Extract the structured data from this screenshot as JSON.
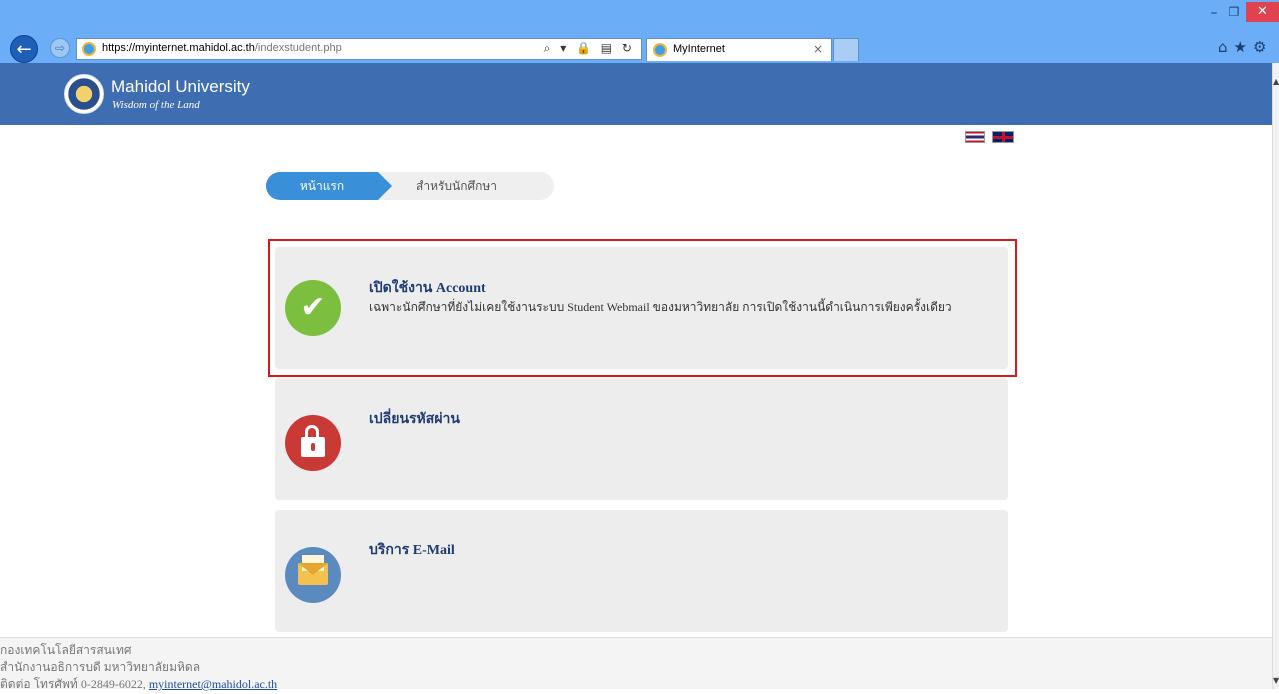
{
  "browser": {
    "url_host": "https://myinternet.mahidol.ac.th",
    "url_path": "/indexstudent.php",
    "address_tools": "⌕ ▾ 🔒 ▤ ↻",
    "tab_title": "MyInternet",
    "tab_close": "×",
    "back_glyph": "←",
    "forward_glyph": "⇨",
    "minimize_glyph": "–",
    "maximize_glyph": "❐",
    "close_glyph": "✕",
    "tool_glyphs": "⌂★⚙"
  },
  "header": {
    "brand_name": "Mahidol University",
    "tagline": "Wisdom of the Land",
    "color": "#3f6db2"
  },
  "breadcrumb": {
    "home": "หน้าแรก",
    "current": "สำหรับนักศึกษา",
    "active_color": "#3a8fd9"
  },
  "services": [
    {
      "title": "เปิดใช้งาน Account",
      "description": "เฉพาะนักศึกษาที่ยังไม่เคยใช้งานระบบ Student Webmail ของมหาวิทยาลัย การเปิดใช้งานนี้ดำเนินการเพียงครั้งเดียว",
      "icon": "check-icon",
      "icon_glyph": "✔",
      "icon_color": "#7cbf3e",
      "highlighted": true
    },
    {
      "title": "เปลี่ยนรหัสผ่าน",
      "icon": "lock-icon",
      "icon_color": "#c93a36"
    },
    {
      "title": "บริการ E-Mail",
      "icon": "envelope-icon",
      "icon_color": "#5b8bbe"
    }
  ],
  "footer": {
    "line1": "กองเทคโนโลยีสารสนเทศ",
    "line2": "สำนักงานอธิการบดี มหาวิทยาลัยมหิดล",
    "line3_prefix": "ติดต่อ โทรศัพท์ 0-2849-6022, ",
    "email": "myinternet@mahidol.ac.th"
  },
  "highlight_color": "#d7191f"
}
